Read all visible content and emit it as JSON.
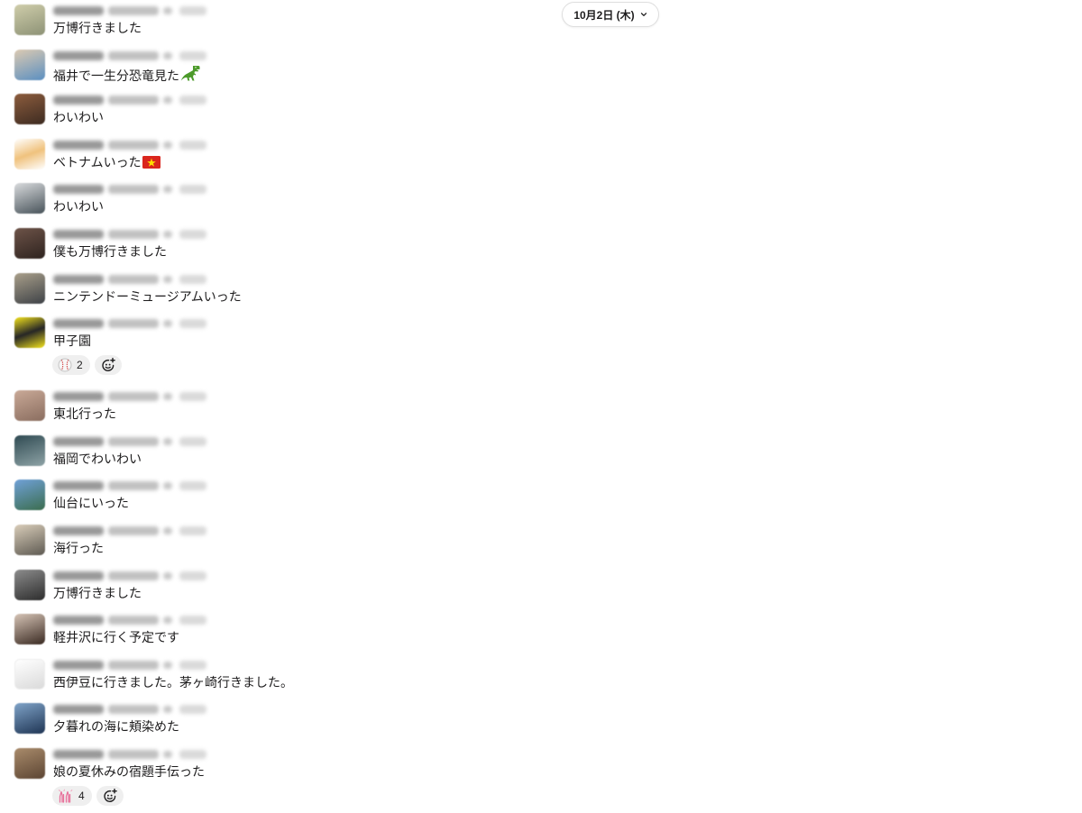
{
  "date_divider": {
    "label": "10月2日 (木)",
    "icon": "chevron-down-icon"
  },
  "messages": [
    {
      "text": "万博行きました",
      "avatar_colors": [
        "#cfcdaa",
        "#8d9276"
      ]
    },
    {
      "text": "福井で一生分恐竜見た",
      "emoji": "t-rex",
      "avatar_colors": [
        "#dccab2",
        "#5b8fc1"
      ]
    },
    {
      "text": "わいわい",
      "avatar_colors": [
        "#8c5c3d",
        "#3d2b21"
      ]
    },
    {
      "text": "ベトナムいった",
      "emoji": "flag-vietnam",
      "avatar_colors": [
        "#ffffff",
        "#f0c27d",
        "#ffffff"
      ]
    },
    {
      "text": "わいわい",
      "avatar_colors": [
        "#d9dbdd",
        "#48535a"
      ]
    },
    {
      "text": "僕も万博行きました",
      "avatar_colors": [
        "#6d5348",
        "#2e231f"
      ]
    },
    {
      "text": "ニンテンドーミュージアムいった",
      "avatar_colors": [
        "#a99f8a",
        "#3e4247"
      ]
    },
    {
      "text": "甲子園",
      "avatar_colors": [
        "#f4e31c",
        "#262626",
        "#f4e31c"
      ],
      "reactions": [
        {
          "emoji": "baseball",
          "count": 2
        }
      ]
    },
    {
      "text": "東北行った",
      "avatar_colors": [
        "#c9a997",
        "#8a6d5f"
      ]
    },
    {
      "text": "福岡でわいわい",
      "avatar_colors": [
        "#2f4a52",
        "#8ea3a6"
      ]
    },
    {
      "text": "仙台にいった",
      "avatar_colors": [
        "#70a1d8",
        "#3b6d4f"
      ]
    },
    {
      "text": "海行った",
      "avatar_colors": [
        "#d9cdb9",
        "#5e5a52"
      ]
    },
    {
      "text": "万博行きました",
      "avatar_colors": [
        "#8c8c8c",
        "#2d2d2d"
      ]
    },
    {
      "text": "軽井沢に行く予定です",
      "avatar_colors": [
        "#d6c4b6",
        "#3a2a22"
      ]
    },
    {
      "text": "西伊豆に行きました。茅ヶ崎行きました。",
      "avatar_colors": [
        "#ffffff",
        "#dadada"
      ]
    },
    {
      "text": "夕暮れの海に頬染めた",
      "avatar_colors": [
        "#7fa3c8",
        "#1f3554"
      ]
    },
    {
      "text": "娘の夏休みの宿題手伝った",
      "avatar_colors": [
        "#a98b6b",
        "#5c4533"
      ],
      "reactions": [
        {
          "emoji": "raised-hands",
          "count": 4
        }
      ]
    }
  ]
}
